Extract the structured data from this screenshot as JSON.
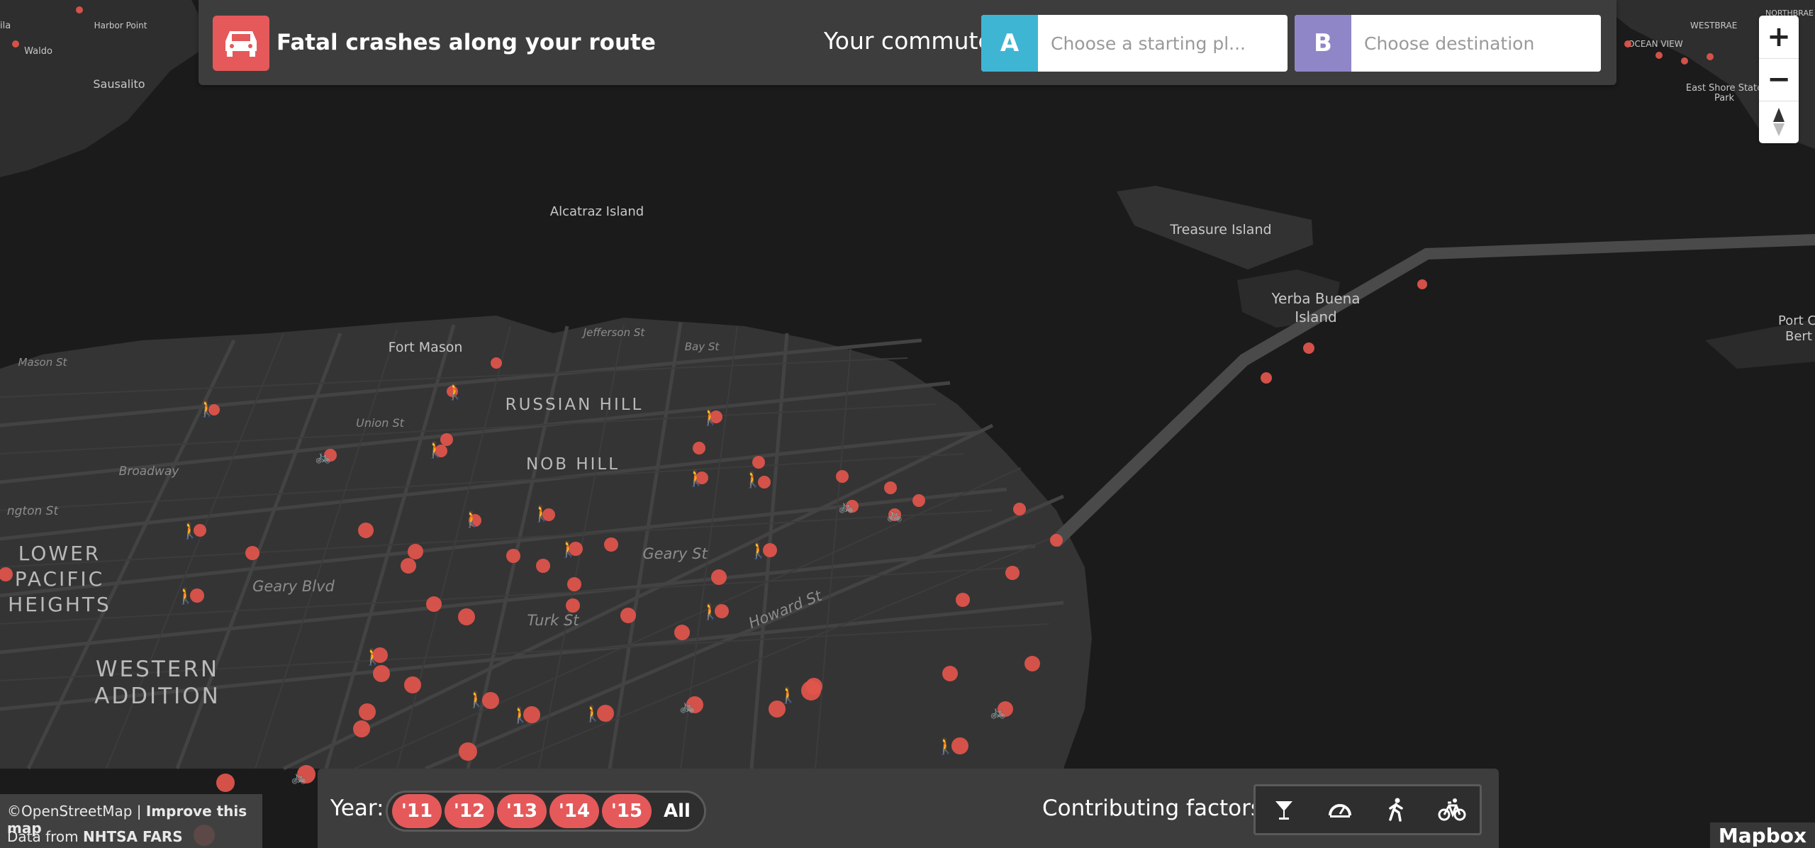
{
  "app": {
    "title": "Fatal crashes along your route",
    "icon": "car-icon"
  },
  "commute": {
    "label": "Your commute:",
    "start": {
      "tag": "A",
      "placeholder": "Choose a starting pl...",
      "value": ""
    },
    "end": {
      "tag": "B",
      "placeholder": "Choose destination",
      "value": ""
    }
  },
  "zoom": {
    "in_label": "+",
    "out_label": "−",
    "compass_icon": "compass-icon"
  },
  "years": {
    "label": "Year:",
    "options": [
      "'11",
      "'12",
      "'13",
      "'14",
      "'15",
      "All"
    ]
  },
  "factors": {
    "label": "Contributing factors:",
    "items": [
      "cocktail-glass-icon",
      "speedometer-icon",
      "pedestrian-icon",
      "bicycle-icon"
    ]
  },
  "map": {
    "neighborhoods": [
      "RUSSIAN HILL",
      "NOB HILL",
      "LOWER",
      "PACIFIC",
      "HEIGHTS",
      "WESTERN",
      "ADDITION"
    ],
    "places": [
      "Alcatraz Island",
      "Treasure Island",
      "Yerba Buena",
      "Island",
      "Fort Mason",
      "Sausalito",
      "Harbor Point",
      "Waldo",
      "East Shore State",
      "Park",
      "Port C",
      "Bert",
      "OCEAN VIEW",
      "WESTBRAE",
      "NORTHBRAE",
      "ila"
    ],
    "streets": [
      "Jefferson St",
      "Bay St",
      "Union St",
      "Broadway",
      "Geary St",
      "Geary Blvd",
      "Turk St",
      "Howard St",
      "Mason St",
      "ngton St"
    ],
    "crash_color": "#e1554b"
  },
  "attribution": {
    "osm": "©OpenStreetMap",
    "separator": " | ",
    "improve": "Improve this map",
    "data_prefix": "Data from ",
    "data_source": "NHTSA FARS"
  },
  "mapbox_logo": "Mapbox"
}
